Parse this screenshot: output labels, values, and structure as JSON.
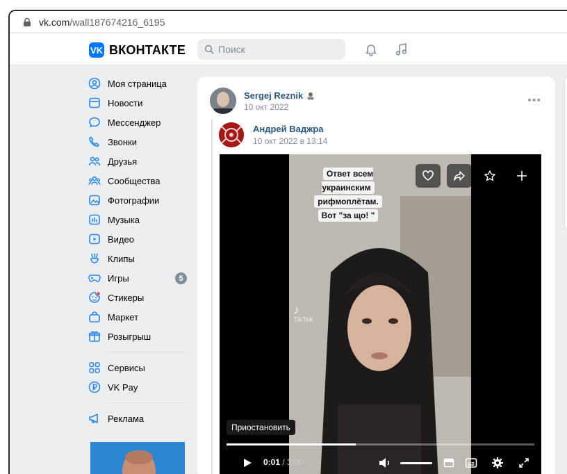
{
  "browser": {
    "url_host": "vk.com",
    "url_path": "/wall187674216_6195"
  },
  "header": {
    "logo_text": "ВКОНТАКТЕ",
    "logo_mark": "VK",
    "search_placeholder": "Поиск",
    "accent": "#0077ff"
  },
  "sidebar": {
    "items": [
      {
        "label": "Моя страница",
        "icon": "profile-icon"
      },
      {
        "label": "Новости",
        "icon": "news-icon"
      },
      {
        "label": "Мессенджер",
        "icon": "messenger-icon"
      },
      {
        "label": "Звонки",
        "icon": "phone-icon"
      },
      {
        "label": "Друзья",
        "icon": "friends-icon"
      },
      {
        "label": "Сообщества",
        "icon": "communities-icon"
      },
      {
        "label": "Фотографии",
        "icon": "photo-icon"
      },
      {
        "label": "Музыка",
        "icon": "music-icon"
      },
      {
        "label": "Видео",
        "icon": "video-icon"
      },
      {
        "label": "Клипы",
        "icon": "clips-icon"
      },
      {
        "label": "Игры",
        "icon": "games-icon",
        "badge": "5"
      },
      {
        "label": "Стикеры",
        "icon": "stickers-icon"
      },
      {
        "label": "Маркет",
        "icon": "market-icon"
      },
      {
        "label": "Розыгрыш",
        "icon": "gift-icon"
      }
    ],
    "items2": [
      {
        "label": "Сервисы",
        "icon": "services-icon"
      },
      {
        "label": "VK Pay",
        "icon": "vkpay-icon"
      }
    ],
    "items3": [
      {
        "label": "Реклама",
        "icon": "ads-icon"
      }
    ]
  },
  "post": {
    "author": "Sergej Reznik",
    "date": "10 окт 2022",
    "repost": {
      "author": "Андрей Ваджра",
      "date": "10 окт 2022 в 13:14"
    },
    "video": {
      "caption": [
        "Ответ всем украинским",
        "рифмоплётам.",
        "Вот \"за що! \""
      ],
      "watermark": "TikTok",
      "tooltip": "Приостановить",
      "current_time": "0:01",
      "total_time": "3:00",
      "progress": 0.42
    }
  }
}
